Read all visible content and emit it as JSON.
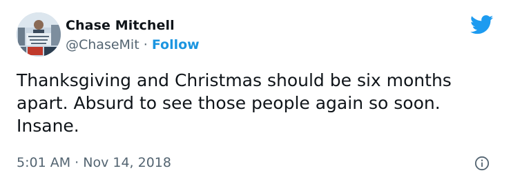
{
  "author": {
    "display_name": "Chase Mitchell",
    "handle": "@ChaseMit",
    "separator": "·",
    "follow_label": "Follow"
  },
  "tweet": {
    "text": "Thanksgiving and Christmas should be six months apart. Absurd to see those people again so soon. Insane.",
    "time": "5:01 AM",
    "date_separator": "·",
    "date": "Nov 14, 2018"
  },
  "icons": {
    "brand": "twitter-bird-icon",
    "info": "info-icon"
  },
  "colors": {
    "brand_blue": "#1d9bf0",
    "follow_blue": "#1b95e0",
    "text_primary": "#0f1419",
    "text_secondary": "#536471"
  }
}
